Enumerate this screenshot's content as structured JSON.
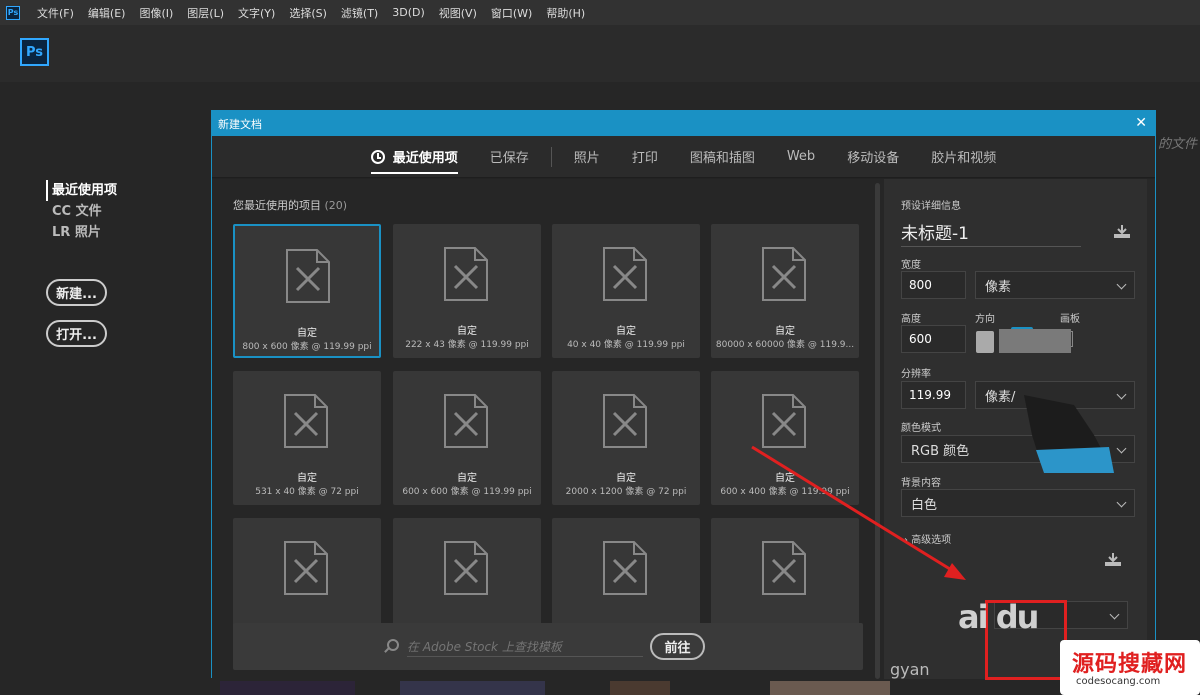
{
  "menu": {
    "app_icon": "Ps",
    "items": [
      "文件(F)",
      "编辑(E)",
      "图像(I)",
      "图层(L)",
      "文字(Y)",
      "选择(S)",
      "滤镜(T)",
      "3D(D)",
      "视图(V)",
      "窗口(W)",
      "帮助(H)"
    ]
  },
  "home": {
    "logo": "Ps",
    "nav": [
      "最近使用项",
      "CC 文件",
      "LR 照片"
    ],
    "new_btn": "新建...",
    "open_btn": "打开...",
    "bg_recent": "的文件"
  },
  "dialog": {
    "title": "新建文档",
    "close": "✕",
    "tabs": [
      "最近使用项",
      "已保存",
      "照片",
      "打印",
      "图稿和插图",
      "Web",
      "移动设备",
      "胶片和视频"
    ],
    "section_title": "您最近使用的项目",
    "section_count": "(20)",
    "cards": [
      {
        "name": "自定",
        "dim": "800 x 600 像素 @ 119.99 ppi"
      },
      {
        "name": "自定",
        "dim": "222 x 43 像素 @ 119.99 ppi"
      },
      {
        "name": "自定",
        "dim": "40 x 40 像素 @ 119.99 ppi"
      },
      {
        "name": "自定",
        "dim": "80000 x 60000 像素 @ 119.9..."
      },
      {
        "name": "自定",
        "dim": "531 x 40 像素 @ 72 ppi"
      },
      {
        "name": "自定",
        "dim": "600 x 600 像素 @ 119.99 ppi"
      },
      {
        "name": "自定",
        "dim": "2000 x 1200 像素 @ 72 ppi"
      },
      {
        "name": "自定",
        "dim": "600 x 400 像素 @ 119.99 ppi"
      },
      {
        "name": "",
        "dim": ""
      },
      {
        "name": "",
        "dim": ""
      },
      {
        "name": "",
        "dim": ""
      },
      {
        "name": "",
        "dim": ""
      }
    ],
    "stock_placeholder": "在 Adobe Stock 上查找模板",
    "stock_btn": "前往"
  },
  "preset": {
    "header": "预设详细信息",
    "doc_name": "未标题-1",
    "width_label": "宽度",
    "width_value": "800",
    "width_unit": "像素",
    "height_label": "高度",
    "height_value": "600",
    "orientation_label": "方向",
    "artboard_label": "画板",
    "resolution_label": "分辨率",
    "resolution_value": "119.99",
    "resolution_unit": "像素/",
    "color_mode_label": "颜色模式",
    "color_mode_value": "RGB 颜色",
    "background_label": "背景内容",
    "background_value": "白色",
    "advanced_label": "高级选项"
  },
  "watermark": {
    "site_name": "源码搜藏网",
    "site_url": "codesocang.com",
    "baidu": "ai du",
    "jingyan": "gyan"
  },
  "colors": {
    "accent": "#1a91c4",
    "arrow": "#e02020"
  }
}
